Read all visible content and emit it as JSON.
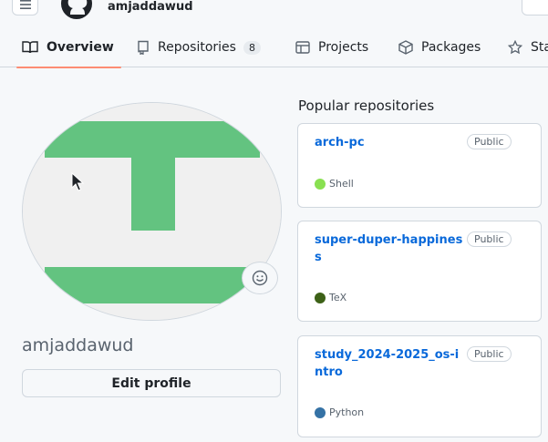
{
  "header": {
    "username": "amjaddawud"
  },
  "tabs": [
    {
      "label": "Overview"
    },
    {
      "label": "Repositories",
      "count": "8"
    },
    {
      "label": "Projects"
    },
    {
      "label": "Packages"
    },
    {
      "label": "Sta"
    }
  ],
  "profile": {
    "name": "amjaddawud",
    "edit_label": "Edit profile"
  },
  "popular": {
    "title": "Popular repositories",
    "repos": [
      {
        "name": "arch-pc",
        "visibility": "Public",
        "language": "Shell",
        "lang_color": "#89e051"
      },
      {
        "name": "super-duper-happiness",
        "visibility": "Public",
        "language": "TeX",
        "lang_color": "#3d6117"
      },
      {
        "name": "study_2024-2025_os-intro",
        "visibility": "Public",
        "language": "Python",
        "lang_color": "#3572A5"
      }
    ]
  },
  "colors": {
    "accent_underline": "#fd8c73",
    "link": "#0969da",
    "avatar_green": "#63c380"
  }
}
